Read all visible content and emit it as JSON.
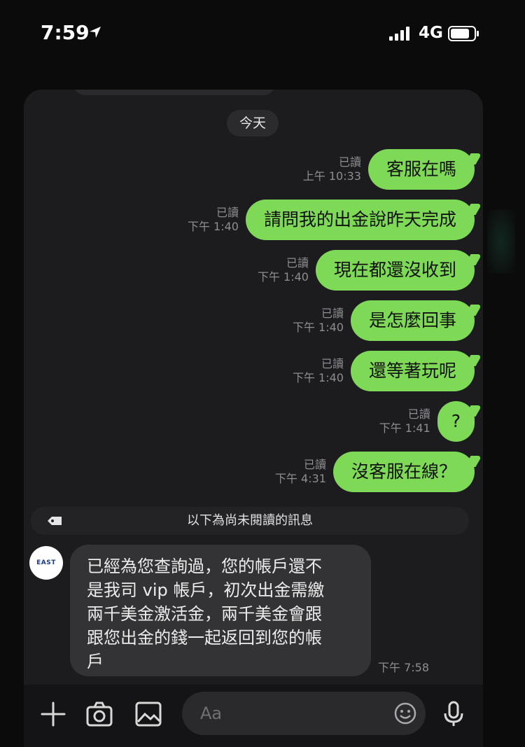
{
  "status": {
    "time": "7:59",
    "network": "4G"
  },
  "chat": {
    "date_label": "今天",
    "outgoing": [
      {
        "read": "已讀",
        "time": "上午 10:33",
        "text": "客服在嗎"
      },
      {
        "read": "已讀",
        "time": "下午 1:40",
        "text": "請問我的出金說昨天完成"
      },
      {
        "read": "已讀",
        "time": "下午 1:40",
        "text": "現在都還沒收到"
      },
      {
        "read": "已讀",
        "time": "下午 1:40",
        "text": "是怎麼回事"
      },
      {
        "read": "已讀",
        "time": "下午 1:40",
        "text": "還等著玩呢"
      },
      {
        "read": "已讀",
        "time": "下午 1:41",
        "text": "?"
      },
      {
        "read": "已讀",
        "time": "下午 4:31",
        "text": "沒客服在線？"
      }
    ],
    "unread_divider": "以下為尚未閱讀的訊息",
    "incoming": {
      "avatar_text": "EAST",
      "lines": [
        "已經為您查詢過，您的帳戶還不",
        "是我司 vip 帳戶，初次出金需繳",
        "兩千美金激活金，兩千美金會跟",
        "跟您出金的錢一起返回到您的帳",
        "戶"
      ],
      "time": "下午 7:58"
    }
  },
  "input": {
    "placeholder": "Aa"
  },
  "colors": {
    "outgoing_bubble": "#7ed957",
    "incoming_bubble": "#333336",
    "background": "#1c1c1e"
  }
}
